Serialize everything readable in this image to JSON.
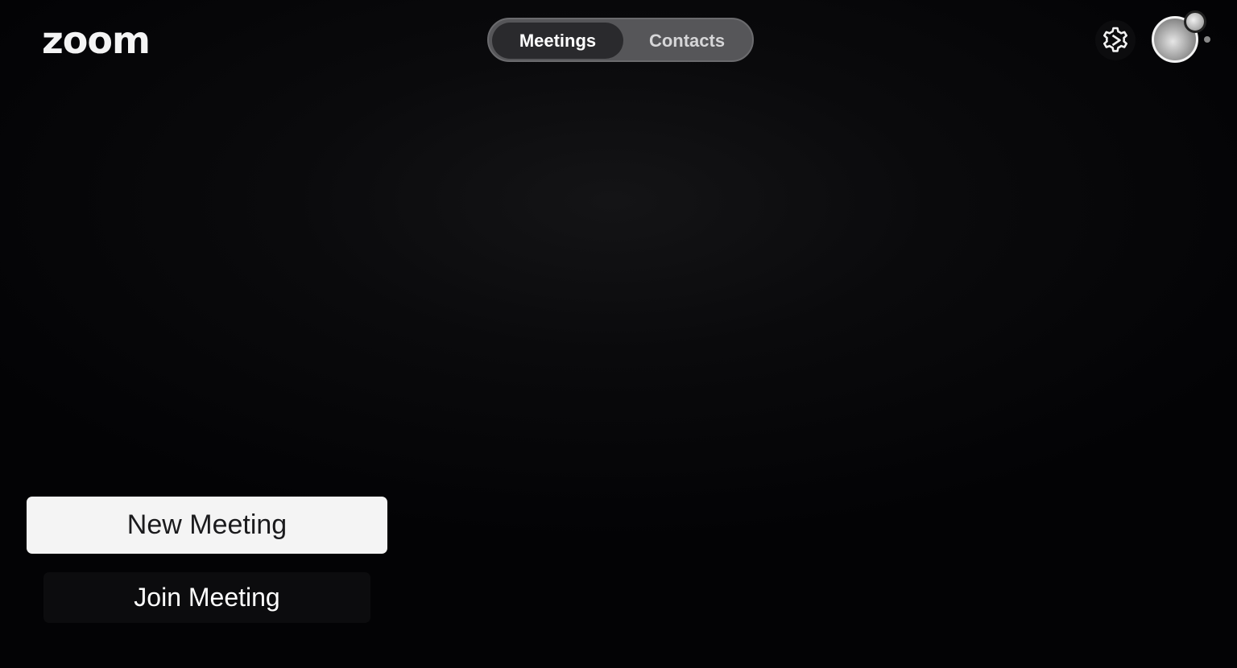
{
  "app": {
    "logo_text": "zoom"
  },
  "header": {
    "tabs": [
      {
        "label": "Meetings",
        "selected": true
      },
      {
        "label": "Contacts",
        "selected": false
      }
    ],
    "settings_icon": "gear-icon",
    "avatar_icon": "user-avatar"
  },
  "actions": {
    "new_meeting_label": "New Meeting",
    "join_meeting_label": "Join Meeting"
  },
  "colors": {
    "background": "#030305",
    "tab_track": "#565659",
    "tab_selected": "#2a2a2d",
    "primary_button": "#f4f4f4",
    "secondary_button": "#0c0c0e"
  }
}
